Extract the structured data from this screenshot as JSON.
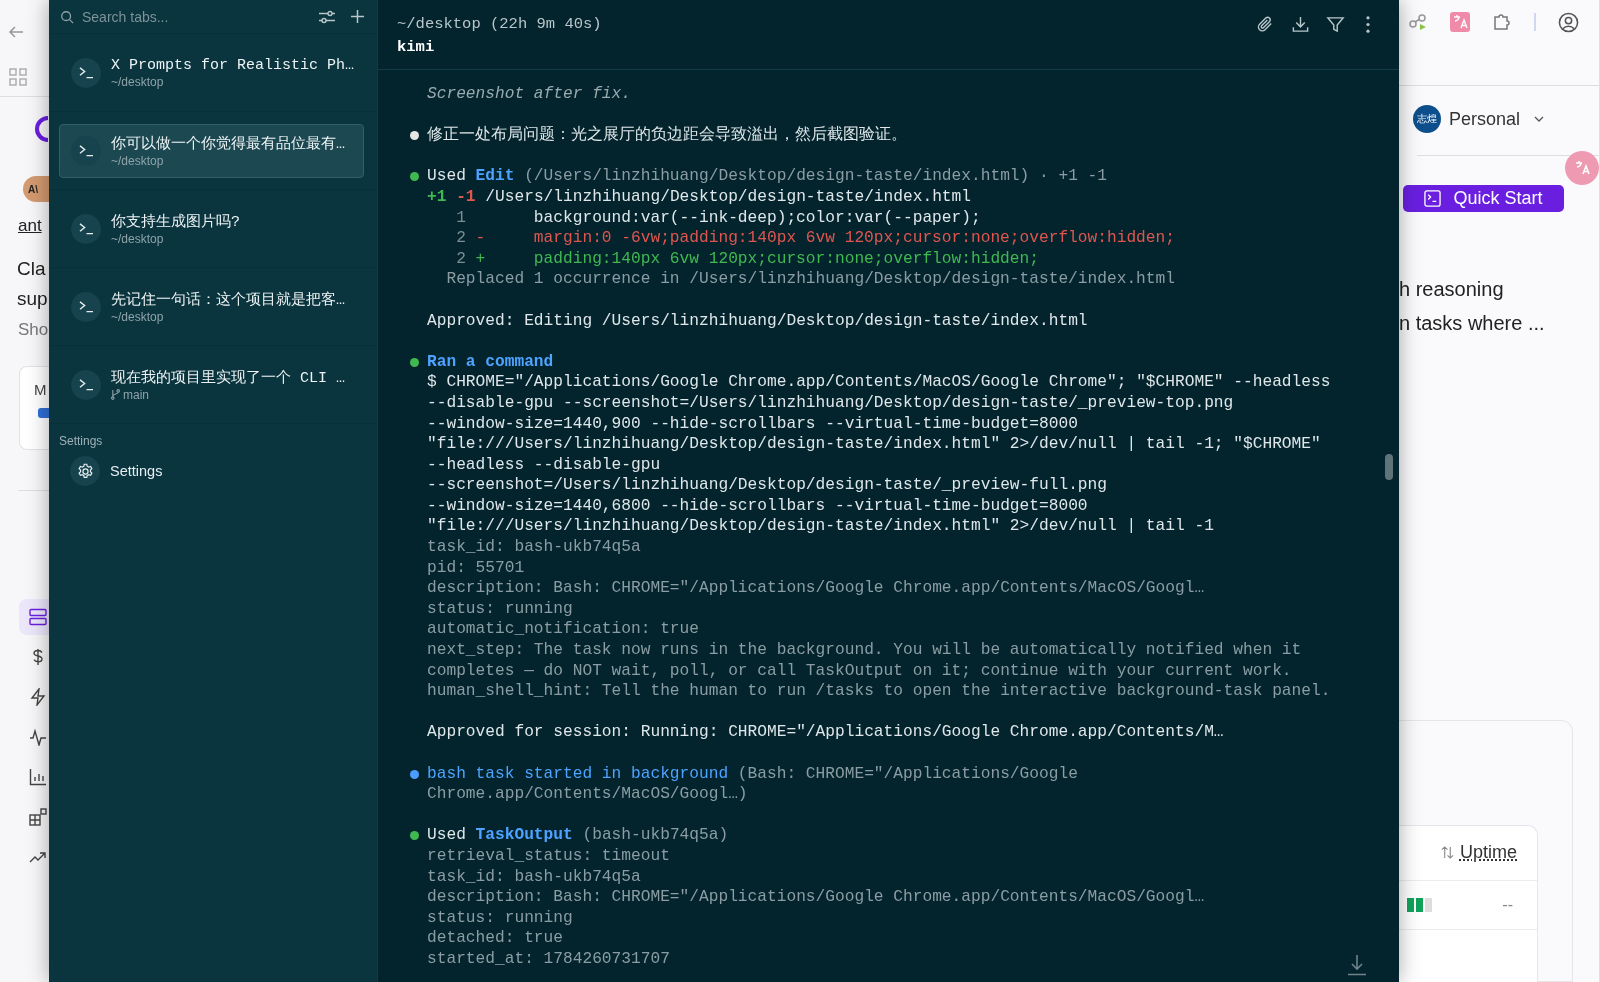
{
  "background_page": {
    "left": {
      "brand": "ant",
      "heading_line_1": "Cla",
      "heading_line_2": "sup",
      "subtext": "Sho",
      "card_text": "M",
      "avatar_text": "A\\"
    },
    "nav": [
      {
        "kind": "servers",
        "selected": true
      },
      {
        "kind": "dollar",
        "selected": false
      },
      {
        "kind": "bolt",
        "selected": false
      },
      {
        "kind": "pulse",
        "selected": false
      },
      {
        "kind": "bars",
        "selected": false
      },
      {
        "kind": "widgets",
        "selected": false
      },
      {
        "kind": "trend",
        "selected": false
      }
    ],
    "workspace": {
      "avatar_text": "志煌",
      "label": "Personal"
    },
    "quick_start": "Quick Start",
    "description_lines": [
      "h reasoning",
      "n tasks where ..."
    ],
    "table": {
      "column": "Uptime",
      "rows": [
        {
          "value": "--"
        }
      ]
    }
  },
  "panel": {
    "search": {
      "placeholder": "Search tabs..."
    },
    "sessions": [
      {
        "title": "X Prompts for Realistic Ph…",
        "subtitle": "~/desktop",
        "kind": "path",
        "selected": false
      },
      {
        "title": "你可以做一个你觉得最有品位最有…",
        "subtitle": "~/desktop",
        "kind": "path",
        "selected": true
      },
      {
        "title": "你支持生成图片吗?",
        "subtitle": "~/desktop",
        "kind": "path",
        "selected": false
      },
      {
        "title": "先记住一句话：这个项目就是把客…",
        "subtitle": "~/desktop",
        "kind": "path",
        "selected": false
      },
      {
        "title": "现在我的项目里实现了一个 CLI …",
        "subtitle": "main",
        "kind": "branch",
        "selected": false
      }
    ],
    "settings_section": {
      "heading": "Settings",
      "item": "Settings"
    },
    "terminal": {
      "path": "~/desktop (22h 9m 40s)",
      "name": "kimi",
      "blocks": [
        {
          "lines": [
            {
              "kind": "text",
              "spans": [
                {
                  "kind": "italic",
                  "text": "Screenshot after fix."
                }
              ]
            }
          ]
        },
        {
          "color": "#e6e6e6",
          "lines": [
            {
              "kind": "text",
              "spans": [
                {
                  "kind": "plain",
                  "text": "修正一处布局问题：光之展厅的负边距会导致溢出，然后截图验证。"
                }
              ]
            }
          ]
        },
        {
          "color": "#3fb950",
          "lines": [
            {
              "kind": "text",
              "spans": [
                {
                  "kind": "plain",
                  "text": "Used "
                },
                {
                  "kind": "tool",
                  "text": "Edit"
                },
                {
                  "kind": "dim",
                  "text": " (/Users/linzhihuang/Desktop/design-taste/index.html) · +1 -1"
                }
              ]
            },
            {
              "kind": "text",
              "spans": [
                {
                  "kind": "add",
                  "text": "+1"
                },
                {
                  "kind": "del",
                  "text": " -1"
                },
                {
                  "kind": "plain",
                  "text": " /Users/linzhihuang/Desktop/design-taste/index.html"
                }
              ]
            },
            {
              "kind": "context",
              "number": "1",
              "code": "background:var(--ink-deep);color:var(--paper);"
            },
            {
              "kind": "del",
              "number": "2",
              "sign": "-",
              "code": "margin:0 -6vw;padding:140px 6vw 120px;cursor:none;overflow:hidden;"
            },
            {
              "kind": "add",
              "number": "2",
              "sign": "+",
              "code": "padding:140px 6vw 120px;cursor:none;overflow:hidden;"
            },
            {
              "kind": "note",
              "spans": [
                {
                  "kind": "dim",
                  "text": "Replaced 1 occurrence in /Users/linzhihuang/Desktop/design-taste/index.html"
                }
              ]
            }
          ]
        },
        {
          "lines": [
            {
              "kind": "text",
              "spans": [
                {
                  "kind": "plain",
                  "text": "Approved: Editing /Users/linzhihuang/Desktop/design-taste/index.html"
                }
              ]
            }
          ]
        },
        {
          "color": "#3fb950",
          "lines": [
            {
              "kind": "text",
              "spans": [
                {
                  "kind": "tool",
                  "text": "Ran a command"
                }
              ]
            },
            {
              "kind": "text",
              "spans": [
                {
                  "kind": "plain",
                  "text": "$ CHROME=\"/Applications/Google Chrome.app/Contents/MacOS/Google Chrome\"; \"$CHROME\" --headless"
                }
              ]
            },
            {
              "kind": "text",
              "spans": [
                {
                  "kind": "plain",
                  "text": "--disable-gpu --screenshot=/Users/linzhihuang/Desktop/design-taste/_preview-top.png"
                }
              ]
            },
            {
              "kind": "text",
              "spans": [
                {
                  "kind": "plain",
                  "text": "--window-size=1440,900 --hide-scrollbars --virtual-time-budget=8000"
                }
              ]
            },
            {
              "kind": "text",
              "spans": [
                {
                  "kind": "plain",
                  "text": "\"file:///Users/linzhihuang/Desktop/design-taste/index.html\" 2>/dev/null | tail -1; \"$CHROME\""
                }
              ]
            },
            {
              "kind": "text",
              "spans": [
                {
                  "kind": "plain",
                  "text": "--headless --disable-gpu"
                }
              ]
            },
            {
              "kind": "text",
              "spans": [
                {
                  "kind": "plain",
                  "text": "--screenshot=/Users/linzhihuang/Desktop/design-taste/_preview-full.png"
                }
              ]
            },
            {
              "kind": "text",
              "spans": [
                {
                  "kind": "plain",
                  "text": "--window-size=1440,6800 --hide-scrollbars --virtual-time-budget=8000"
                }
              ]
            },
            {
              "kind": "text",
              "spans": [
                {
                  "kind": "plain",
                  "text": "\"file:///Users/linzhihuang/Desktop/design-taste/index.html\" 2>/dev/null | tail -1"
                }
              ]
            },
            {
              "kind": "text",
              "spans": [
                {
                  "kind": "dim",
                  "text": "task_id: bash-ukb74q5a"
                }
              ]
            },
            {
              "kind": "text",
              "spans": [
                {
                  "kind": "dim",
                  "text": "pid: 55701"
                }
              ]
            },
            {
              "kind": "text",
              "spans": [
                {
                  "kind": "dim",
                  "text": "description: Bash: CHROME=\"/Applications/Google Chrome.app/Contents/MacOS/Googl…"
                }
              ]
            },
            {
              "kind": "text",
              "spans": [
                {
                  "kind": "dim",
                  "text": "status: running"
                }
              ]
            },
            {
              "kind": "text",
              "spans": [
                {
                  "kind": "dim",
                  "text": "automatic_notification: true"
                }
              ]
            },
            {
              "kind": "text",
              "spans": [
                {
                  "kind": "dim",
                  "text": "next_step: The task now runs in the background. You will be automatically notified when it"
                }
              ]
            },
            {
              "kind": "text",
              "spans": [
                {
                  "kind": "dim",
                  "text": "completes — do NOT wait, poll, or call TaskOutput on it; continue with your current work."
                }
              ]
            },
            {
              "kind": "text",
              "spans": [
                {
                  "kind": "dim",
                  "text": "human_shell_hint: Tell the human to run /tasks to open the interactive background-task panel."
                }
              ]
            }
          ]
        },
        {
          "lines": [
            {
              "kind": "text",
              "spans": [
                {
                  "kind": "plain",
                  "text": "Approved for session: Running: CHROME=\"/Applications/Google Chrome.app/Contents/M…"
                }
              ]
            }
          ]
        },
        {
          "color": "#4a9eff",
          "lines": [
            {
              "kind": "text",
              "spans": [
                {
                  "kind": "link",
                  "text": "bash task started in background"
                },
                {
                  "kind": "dim",
                  "text": " (Bash: CHROME=\"/Applications/Google"
                }
              ]
            },
            {
              "kind": "text",
              "spans": [
                {
                  "kind": "dim",
                  "text": "Chrome.app/Contents/MacOS/Googl…)"
                }
              ]
            }
          ]
        },
        {
          "color": "#3fb950",
          "lines": [
            {
              "kind": "text",
              "spans": [
                {
                  "kind": "plain",
                  "text": "Used "
                },
                {
                  "kind": "tool",
                  "text": "TaskOutput"
                },
                {
                  "kind": "dim",
                  "text": " (bash-ukb74q5a)"
                }
              ]
            },
            {
              "kind": "text",
              "spans": [
                {
                  "kind": "dim",
                  "text": "retrieval_status: timeout"
                }
              ]
            },
            {
              "kind": "text",
              "spans": [
                {
                  "kind": "dim",
                  "text": "task_id: bash-ukb74q5a"
                }
              ]
            },
            {
              "kind": "text",
              "spans": [
                {
                  "kind": "dim",
                  "text": "description: Bash: CHROME=\"/Applications/Google Chrome.app/Contents/MacOS/Googl…"
                }
              ]
            },
            {
              "kind": "text",
              "spans": [
                {
                  "kind": "dim",
                  "text": "status: running"
                }
              ]
            },
            {
              "kind": "text",
              "spans": [
                {
                  "kind": "dim",
                  "text": "detached: true"
                }
              ]
            },
            {
              "kind": "text",
              "spans": [
                {
                  "kind": "dim",
                  "text": "started_at: 1784260731707"
                }
              ]
            }
          ]
        }
      ]
    }
  }
}
